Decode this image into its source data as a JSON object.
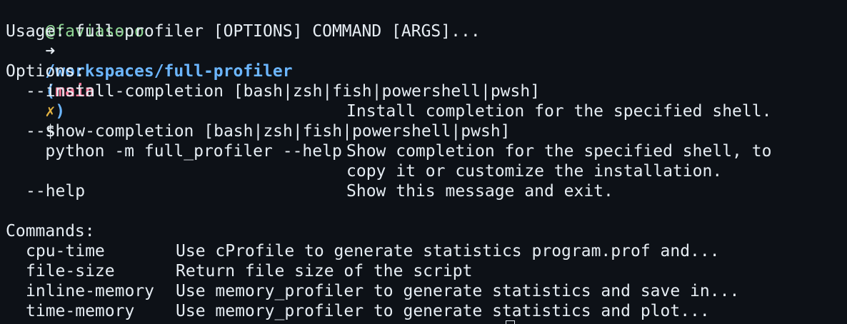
{
  "prompt": {
    "user": "@faviasono",
    "arrow": "➜",
    "path": "/workspaces/full-profiler",
    "branch_open": "(",
    "branch": "main",
    "dirty": "✗",
    "branch_close": ")",
    "symbol": "$",
    "command": "python -m full_profiler --help"
  },
  "usage": "Usage: full-profiler [OPTIONS] COMMAND [ARGS]...",
  "options": {
    "header": "Options:",
    "install_completion": {
      "flag": "--install-completion [bash|zsh|fish|powershell|pwsh]",
      "desc": "Install completion for the specified shell."
    },
    "show_completion": {
      "flag": "--show-completion [bash|zsh|fish|powershell|pwsh]",
      "desc_line1": "Show completion for the specified shell, to",
      "desc_line2": "copy it or customize the installation."
    },
    "help": {
      "flag": "--help",
      "desc": "Show this message and exit."
    }
  },
  "commands": {
    "header": "Commands:",
    "items": [
      {
        "name": "cpu-time",
        "desc": "Use cProfile to generate statistics program.prof and..."
      },
      {
        "name": "file-size",
        "desc": "Return file size of the script"
      },
      {
        "name": "inline-memory",
        "desc": "Use memory_profiler to generate statistics and save in..."
      },
      {
        "name": "time-memory",
        "desc": "Use memory_profiler to generate statistics and plot..."
      }
    ]
  }
}
